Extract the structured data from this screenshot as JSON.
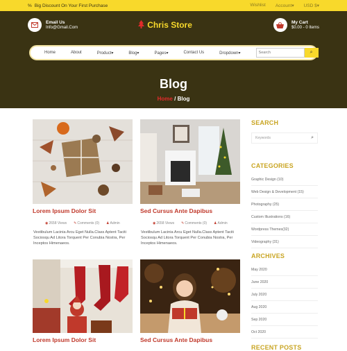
{
  "topbar": {
    "promo_icon": "percent-icon",
    "promo": "Big Discount On Your First Purchase",
    "links": [
      "Wishlist",
      "Account",
      "USD $"
    ]
  },
  "header": {
    "email_label": "Email Us",
    "email_value": "Info@Gmail.Com",
    "logo": "Chris Store",
    "cart_label": "My Cart",
    "cart_value": "$0.00 - 0 Items"
  },
  "nav": {
    "items": [
      "Home",
      "About",
      "Product",
      "Blog",
      "Pages",
      "Contact Us",
      "Dropdown"
    ],
    "search_placeholder": "Search"
  },
  "page": {
    "title": "Blog",
    "crumb_home": "Home",
    "crumb_sep": "/",
    "crumb_current": "Blog"
  },
  "posts": [
    {
      "title": "Lorem Ipsum Dolor Sit",
      "views": "2658 Views",
      "comments": "Comments (0)",
      "author": "Admin",
      "excerpt": "Vestibulum Lacinia Arcu Eget Nulla.Class Aptent Taciti Sociosqu Ad Litora Torquent Per Conubia Nostra, Per Inceptos Himenaeos."
    },
    {
      "title": "Sed Cursus Ante Dapibus",
      "views": "2658 Views",
      "comments": "Comments (0)",
      "author": "Admin",
      "excerpt": "Vestibulum Lacinia Arcu Eget Nulla.Class Aptent Taciti Sociosqu Ad Litora Torquent Per Conubia Nostra, Per Inceptos Himenaeos."
    },
    {
      "title": "Lorem Ipsum Dolor Sit"
    },
    {
      "title": "Sed Cursus Ante Dapibus"
    }
  ],
  "sidebar": {
    "search_heading": "SEARCH",
    "search_placeholder": "Keywords",
    "categories_heading": "CATEGORIES",
    "categories": [
      "Graphic Design (10)",
      "Web Design & Development (15)",
      "Photography (25)",
      "Custom Illustrations (16)",
      "Wordpress Themes(32)",
      "Videography (31)"
    ],
    "archives_heading": "ARCHIVES",
    "archives": [
      "May 2020",
      "June 2020",
      "July 2020",
      "Aug 2020",
      "Sep 2020",
      "Oct 2020"
    ],
    "recent_heading": "RECENT POSTS"
  },
  "colors": {
    "accent": "#f8d92b",
    "brand_dark": "#3a3313",
    "red": "#c0392b",
    "heading_gold": "#c9a523"
  }
}
